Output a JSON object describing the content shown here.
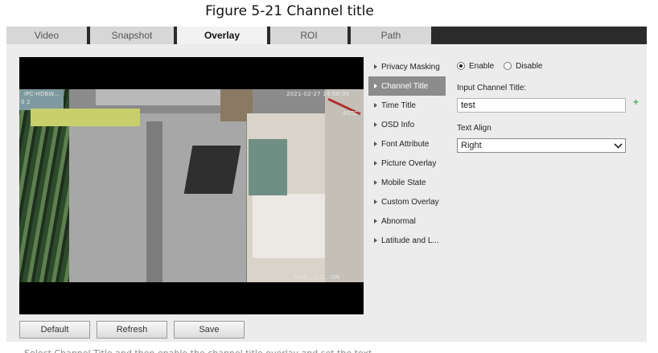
{
  "caption": "Figure 5-21 Channel title",
  "tabs": [
    {
      "label": "Video"
    },
    {
      "label": "Snapshot"
    },
    {
      "label": "Overlay",
      "active": true
    },
    {
      "label": "ROI"
    },
    {
      "label": "Path"
    }
  ],
  "video": {
    "channel_osd": "IPC-HDBW...",
    "time_osd": "2021-02-27 14:58:05",
    "right_osd": "4GTC",
    "bottom_osd": "Fridl... 1-C...ON",
    "side_osd": "0 2"
  },
  "menu": {
    "items": [
      {
        "label": "Privacy Masking"
      },
      {
        "label": "Channel Title",
        "active": true
      },
      {
        "label": "Time Title"
      },
      {
        "label": "OSD Info"
      },
      {
        "label": "Font Attribute"
      },
      {
        "label": "Picture Overlay"
      },
      {
        "label": "Mobile State"
      },
      {
        "label": "Custom Overlay"
      },
      {
        "label": "Abnormal"
      },
      {
        "label": "Latitude and L..."
      }
    ]
  },
  "form": {
    "enable_label": "Enable",
    "disable_label": "Disable",
    "enabled": true,
    "input_label": "Input Channel Title:",
    "input_value": "test",
    "align_label": "Text Align",
    "align_value": "Right",
    "plus_icon": "plus-icon"
  },
  "buttons": {
    "default_label": "Default",
    "refresh_label": "Refresh",
    "save_label": "Save"
  },
  "footer": "Select Channel Title and then enable the channel title overlay and set the text..."
}
